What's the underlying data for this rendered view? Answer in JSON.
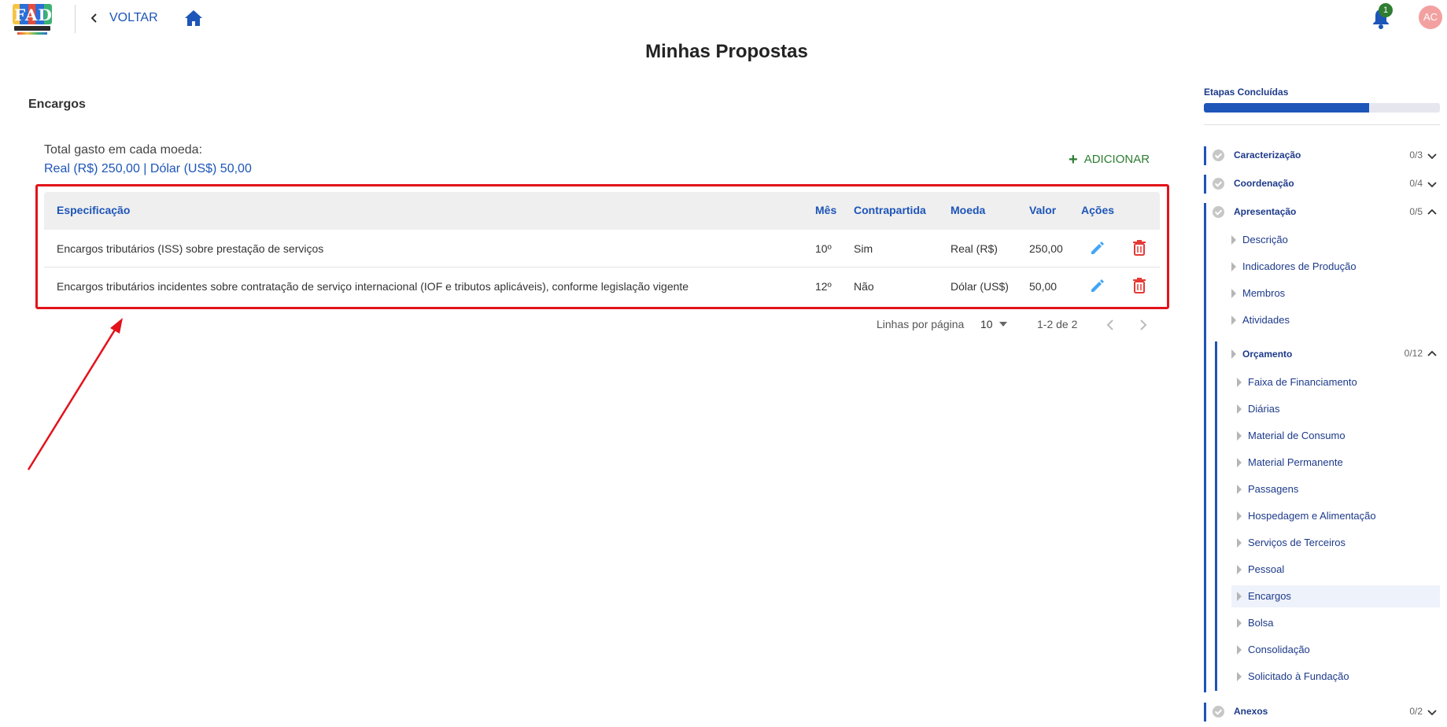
{
  "header": {
    "logo_text": "FADES",
    "back_label": "VOLTAR",
    "notification_count": "1",
    "avatar_initials": "AC"
  },
  "page_title": "Minhas Propostas",
  "section_title": "Encargos",
  "totals": {
    "label": "Total gasto em cada moeda:",
    "values": "Real (R$) 250,00 | Dólar (US$) 50,00"
  },
  "add_button": "ADICIONAR",
  "table": {
    "headers": [
      "Especificação",
      "Mês",
      "Contrapartida",
      "Moeda",
      "Valor",
      "Ações"
    ],
    "rows": [
      {
        "especificacao": "Encargos tributários (ISS) sobre prestação de serviços",
        "mes": "10º",
        "contrapartida": "Sim",
        "moeda": "Real (R$)",
        "valor": "250,00"
      },
      {
        "especificacao": "Encargos tributários incidentes sobre contratação de serviço internacional (IOF e tributos aplicáveis), conforme legislação vigente",
        "mes": "12º",
        "contrapartida": "Não",
        "moeda": "Dólar (US$)",
        "valor": "50,00"
      }
    ]
  },
  "pagination": {
    "rows_per_page_label": "Linhas por página",
    "rows_per_page": "10",
    "range": "1-2 de 2"
  },
  "sidebar": {
    "title": "Etapas Concluídas",
    "progress": 0.7,
    "sections": [
      {
        "label": "Caracterização",
        "count": "0/3",
        "expanded": false
      },
      {
        "label": "Coordenação",
        "count": "0/4",
        "expanded": false
      },
      {
        "label": "Apresentação",
        "count": "0/5",
        "expanded": true
      },
      {
        "label": "Anexos",
        "count": "0/2",
        "expanded": false
      }
    ],
    "apresentacao_items": [
      "Descrição",
      "Indicadores de Produção",
      "Membros",
      "Atividades"
    ],
    "orcamento": {
      "label": "Orçamento",
      "count": "0/12",
      "items": [
        "Faixa de Financiamento",
        "Diárias",
        "Material de Consumo",
        "Material Permanente",
        "Passagens",
        "Hospedagem e Alimentação",
        "Serviços de Terceiros",
        "Pessoal",
        "Encargos",
        "Bolsa",
        "Consolidação",
        "Solicitado à Fundação"
      ],
      "active_item": "Encargos"
    }
  },
  "colors": {
    "primary": "#1d55b8",
    "highlight": "#e3131b",
    "add": "#2e7d32",
    "delete": "#e53935",
    "edit": "#42a5f5"
  }
}
